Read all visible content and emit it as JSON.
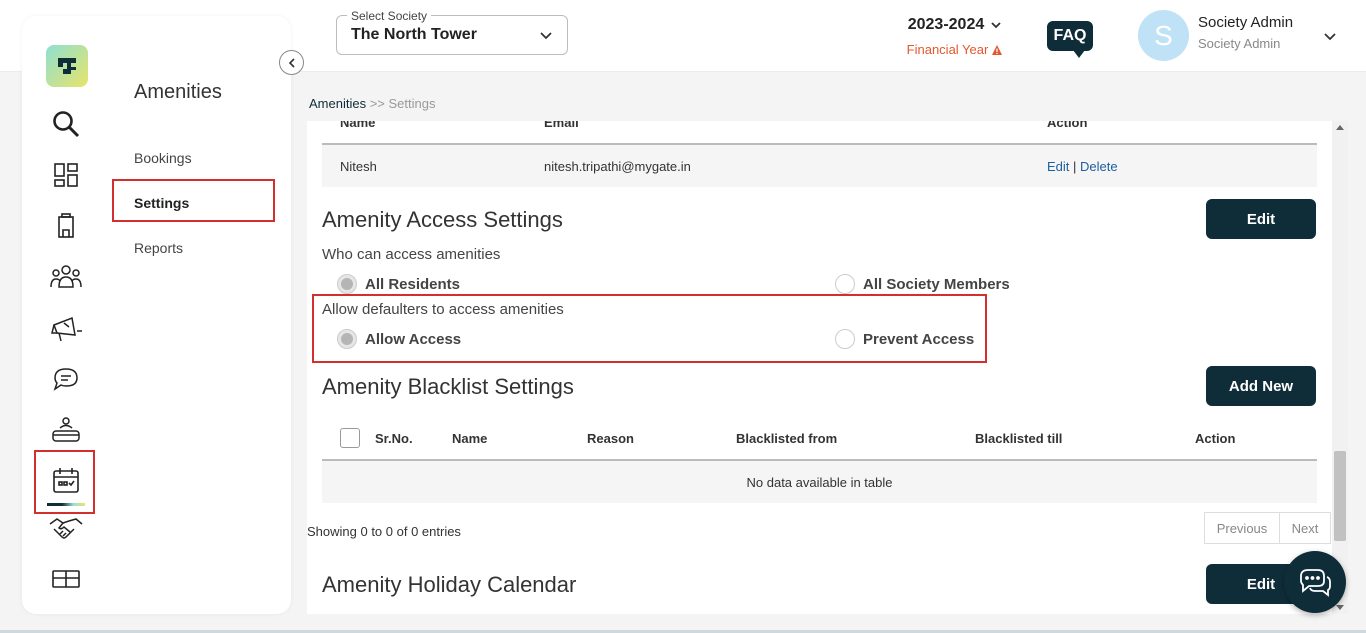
{
  "header": {
    "society_label": "Select Society",
    "society_value": "The North Tower",
    "financial_year": "2023-2024",
    "financial_year_label": "Financial Year",
    "faq": "FAQ",
    "avatar_letter": "S",
    "user_name": "Society Admin",
    "user_role": "Society Admin"
  },
  "sidebar": {
    "title": "Amenities",
    "items": [
      {
        "label": "Bookings"
      },
      {
        "label": "Settings"
      },
      {
        "label": "Reports"
      }
    ],
    "rail_icons": [
      "search-icon",
      "dashboard-icon",
      "building-icon",
      "community-icon",
      "notice-icon",
      "chat-icon",
      "helpdesk-icon",
      "amenities-calendar-icon",
      "handshake-icon",
      "gift-icon"
    ]
  },
  "breadcrumb": {
    "root": "Amenities",
    "sep": " >> ",
    "current": "Settings"
  },
  "managers_table": {
    "headers": [
      "Name",
      "Email",
      "Action"
    ],
    "rows": [
      {
        "name": "Nitesh",
        "email": "nitesh.tripathi@mygate.in",
        "edit": "Edit",
        "sep": " | ",
        "delete": "Delete"
      }
    ]
  },
  "access_settings": {
    "title": "Amenity Access Settings",
    "edit": "Edit",
    "who_question": "Who can access amenities",
    "who_options": [
      "All Residents",
      "All Society Members"
    ],
    "who_selected": "All Residents",
    "defaulter_question": "Allow defaulters to access amenities",
    "defaulter_options": [
      "Allow Access",
      "Prevent Access"
    ],
    "defaulter_selected": "Allow Access"
  },
  "blacklist": {
    "title": "Amenity Blacklist Settings",
    "add_new": "Add New",
    "headers": [
      "Sr.No.",
      "Name",
      "Reason",
      "Blacklisted from",
      "Blacklisted till",
      "Action"
    ],
    "empty": "No data available in table",
    "info": "Showing 0 to 0 of 0 entries",
    "prev": "Previous",
    "next": "Next"
  },
  "holiday": {
    "title": "Amenity Holiday Calendar",
    "edit": "Edit"
  },
  "colors": {
    "primary": "#0f2d39",
    "highlight": "#d32f2f",
    "warning": "#e4572e",
    "link": "#1b5f9e"
  }
}
